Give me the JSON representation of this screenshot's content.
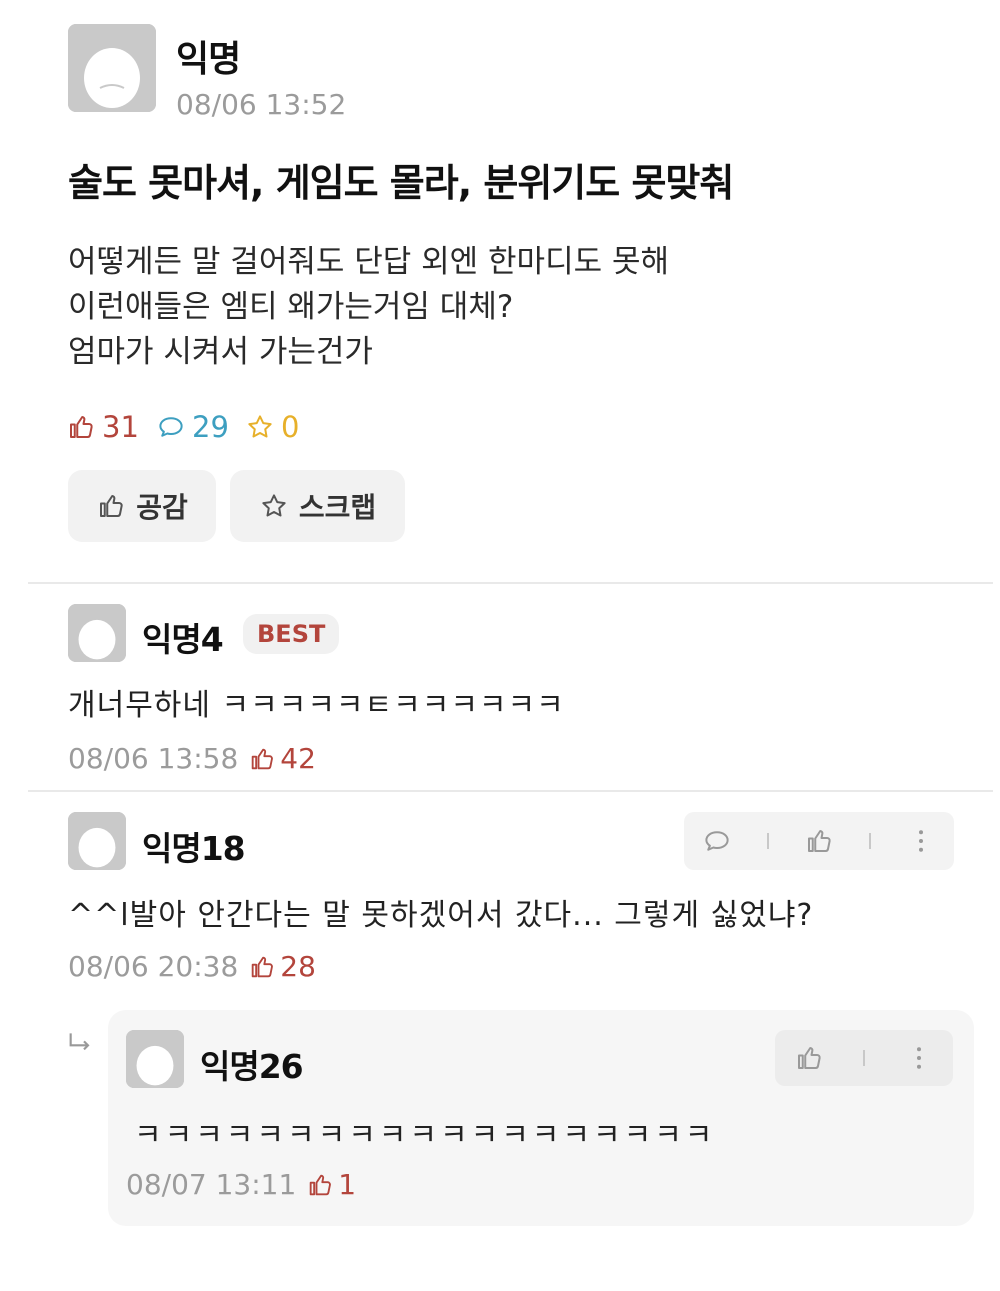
{
  "post": {
    "author": "익명",
    "time": "08/06 13:52",
    "title": "술도 못마셔, 게임도 몰라, 분위기도 못맞춰",
    "body": [
      "어떻게든 말 걸어줘도 단답 외엔 한마디도 못해",
      "이런애들은 엠티 왜가는거임 대체?",
      "엄마가 시켜서 가는건가"
    ],
    "likes": "31",
    "comments": "29",
    "scraps": "0",
    "like_button": "공감",
    "scrap_button": "스크랩"
  },
  "comments": [
    {
      "author": "익명4",
      "badge": "BEST",
      "text": "개너무하네 ㅋㅋㅋㅋㅋㅌㅋㅋㅋㅋㅋㅋ",
      "time": "08/06 13:58",
      "likes": "42"
    },
    {
      "author": "익명18",
      "text": "^^l발아 안간다는 말 못하겠어서 갔다...  그렇게 싫었냐?",
      "time": "08/06 20:38",
      "likes": "28"
    }
  ],
  "reply": {
    "author": "익명26",
    "text": "ㅋㅋㅋㅋㅋㅋㅋㅋㅋㅋㅋㅋㅋㅋㅋㅋㅋㅋㅋ",
    "time": "08/07 13:11",
    "likes": "1"
  },
  "colors": {
    "like": "#b3453c",
    "comment": "#3d9fc0",
    "scrap": "#e7b02a",
    "meta": "#9b9b9b",
    "panel": "#f2f2f2"
  },
  "icons": [
    "thumbs-up-icon",
    "comment-bubble-icon",
    "star-icon",
    "more-vertical-icon",
    "reply-arrow-icon",
    "avatar-placeholder-icon"
  ]
}
